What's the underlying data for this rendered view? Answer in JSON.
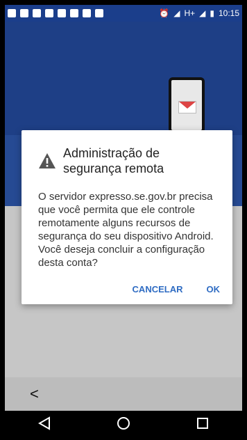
{
  "status_bar": {
    "time": "10:15",
    "network": "H+"
  },
  "dialog": {
    "title": "Administração de segurança remota",
    "message": "O servidor expresso.se.gov.br precisa que você permita que ele controle remotamente alguns recursos de segurança do seu dispositivo Android. Você deseja concluir a configuração desta conta?",
    "cancel_label": "CANCELAR",
    "ok_label": "OK"
  },
  "nav": {
    "back_chevron": "<"
  },
  "colors": {
    "accent": "#2f6cc3",
    "header": "#1e3f86"
  },
  "icons": [
    "warning-icon",
    "back-chevron-icon",
    "nav-back-icon",
    "nav-home-icon",
    "nav-recents-icon"
  ]
}
